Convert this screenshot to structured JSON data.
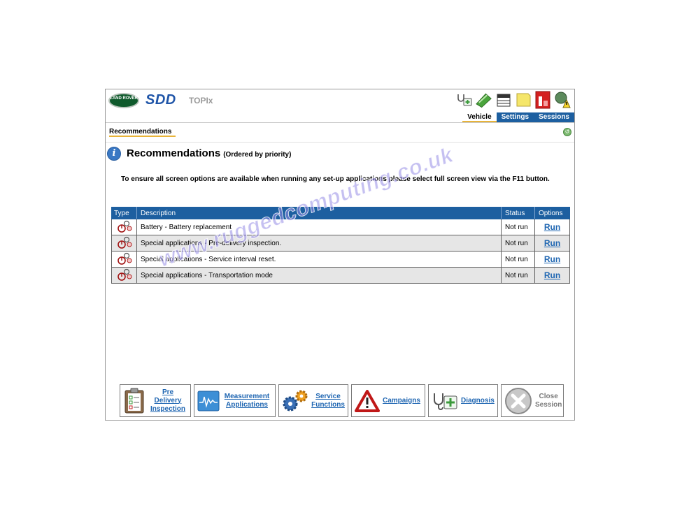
{
  "header": {
    "brand_logo_text": "LAND ROVER",
    "app_name": "SDD",
    "product_name": "TOPIx",
    "tabs": [
      {
        "label": "Vehicle",
        "active": true
      },
      {
        "label": "Settings",
        "active": false
      },
      {
        "label": "Sessions",
        "active": false
      }
    ],
    "toolbar_icons": [
      "stethoscope-icon",
      "tape-icon",
      "calendar-icon",
      "notes-icon",
      "red-alert-icon",
      "network-warning-icon"
    ]
  },
  "breadcrumb": {
    "label": "Recommendations"
  },
  "main": {
    "title": "Recommendations",
    "subtitle": "(Ordered by priority)",
    "notice": "To ensure all screen options are available when running any set-up applications please select full screen view via the F11 button.",
    "table": {
      "columns": [
        "Type",
        "Description",
        "Status",
        "Options"
      ],
      "rows": [
        {
          "description": "Battery - Battery replacement",
          "status": "Not run",
          "option": "Run"
        },
        {
          "description": "Special applications - Pre-delivery inspection.",
          "status": "Not run",
          "option": "Run"
        },
        {
          "description": "Special applications - Service interval reset.",
          "status": "Not run",
          "option": "Run"
        },
        {
          "description": "Special applications - Transportation mode",
          "status": "Not run",
          "option": "Run"
        }
      ]
    }
  },
  "footer": {
    "buttons": [
      {
        "label": "Pre Delivery Inspection",
        "icon": "clipboard-icon"
      },
      {
        "label": "Measurement Applications",
        "icon": "waveform-icon"
      },
      {
        "label": "Service Functions",
        "icon": "gears-icon"
      },
      {
        "label": "Campaigns",
        "icon": "warning-triangle-icon"
      },
      {
        "label": "Diagnosis",
        "icon": "stethoscope-icon"
      },
      {
        "label": "Close Session",
        "icon": "close-icon"
      }
    ]
  },
  "watermark": "www.ruggedcomputing.co.uk",
  "colors": {
    "accent": "#1d5fa0",
    "highlight": "#e8b43a",
    "link": "#1f66b2",
    "row_alt": "#e6e6e6"
  }
}
